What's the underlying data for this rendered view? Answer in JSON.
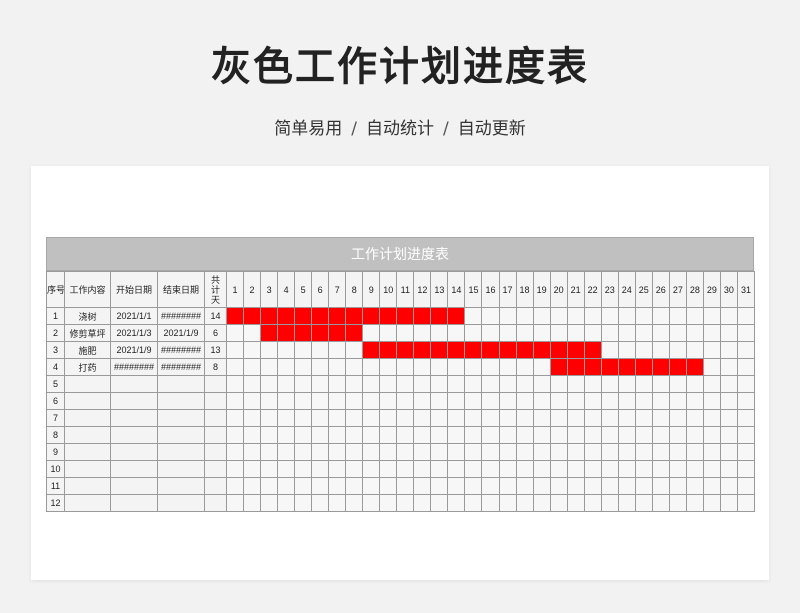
{
  "page": {
    "title": "灰色工作计划进度表",
    "subtitle_parts": [
      "简单易用",
      "自动统计",
      "自动更新"
    ],
    "separator": "/"
  },
  "sheet": {
    "title": "工作计划进度表",
    "headers": {
      "index": "序号",
      "task": "工作内容",
      "start": "开始日期",
      "end": "结束日期",
      "days": "共计天"
    },
    "day_numbers": [
      1,
      2,
      3,
      4,
      5,
      6,
      7,
      8,
      9,
      10,
      11,
      12,
      13,
      14,
      15,
      16,
      17,
      18,
      19,
      20,
      21,
      22,
      23,
      24,
      25,
      26,
      27,
      28,
      29,
      30,
      31
    ],
    "rows": [
      {
        "index": "1",
        "task": "浇树",
        "start": "2021/1/1",
        "end": "########",
        "days": "14",
        "bar_start_day": 1,
        "bar_end_day": 14
      },
      {
        "index": "2",
        "task": "修剪草坪",
        "start": "2021/1/3",
        "end": "2021/1/9",
        "days": "6",
        "bar_start_day": 3,
        "bar_end_day": 8
      },
      {
        "index": "3",
        "task": "施肥",
        "start": "2021/1/9",
        "end": "########",
        "days": "13",
        "bar_start_day": 9,
        "bar_end_day": 22
      },
      {
        "index": "4",
        "task": "打药",
        "start": "########",
        "end": "########",
        "days": "8",
        "bar_start_day": 20,
        "bar_end_day": 28
      },
      {
        "index": "5",
        "task": "",
        "start": "",
        "end": "",
        "days": ""
      },
      {
        "index": "6",
        "task": "",
        "start": "",
        "end": "",
        "days": ""
      },
      {
        "index": "7",
        "task": "",
        "start": "",
        "end": "",
        "days": ""
      },
      {
        "index": "8",
        "task": "",
        "start": "",
        "end": "",
        "days": ""
      },
      {
        "index": "9",
        "task": "",
        "start": "",
        "end": "",
        "days": ""
      },
      {
        "index": "10",
        "task": "",
        "start": "",
        "end": "",
        "days": ""
      },
      {
        "index": "11",
        "task": "",
        "start": "",
        "end": "",
        "days": ""
      },
      {
        "index": "12",
        "task": "",
        "start": "",
        "end": "",
        "days": ""
      }
    ],
    "bar_color": "#ff0000",
    "header_bar_color": "#c0c0c0"
  }
}
